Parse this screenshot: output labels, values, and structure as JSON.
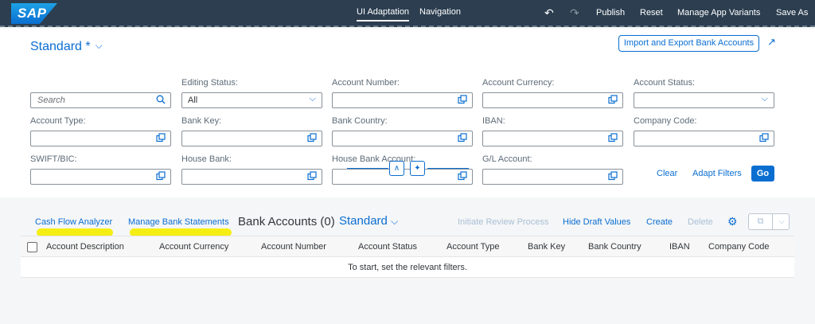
{
  "shell": {
    "logo": "SAP",
    "tabs": [
      "UI Adaptation",
      "Navigation"
    ],
    "undo_icon": "undo-icon",
    "redo_icon": "redo-icon",
    "actions": [
      "Publish",
      "Reset",
      "Manage App Variants",
      "Save As"
    ]
  },
  "header": {
    "variant": "Standard *",
    "import_export": "Import and Export Bank Accounts"
  },
  "filters": {
    "search_placeholder": "Search",
    "editing_status": {
      "label": "Editing Status:",
      "value": "All"
    },
    "account_number": "Account Number:",
    "account_currency": "Account Currency:",
    "account_status": "Account Status:",
    "account_type": "Account Type:",
    "bank_key": "Bank Key:",
    "bank_country": "Bank Country:",
    "iban": "IBAN:",
    "company_code": "Company Code:",
    "swift_bic": "SWIFT/BIC:",
    "house_bank": "House Bank:",
    "house_bank_account": "House Bank Account:",
    "gl_account": "G/L Account:",
    "clear": "Clear",
    "adapt": "Adapt Filters",
    "go": "Go"
  },
  "table": {
    "cash_flow": "Cash Flow Analyzer",
    "manage_statements": "Manage Bank Statements",
    "title": "Bank Accounts (0)",
    "variant": "Standard",
    "initiate_review": "Initiate Review Process",
    "hide_draft": "Hide Draft Values",
    "create": "Create",
    "delete": "Delete",
    "columns": [
      "Account Description",
      "Account Currency",
      "Account Number",
      "Account Status",
      "Account Type",
      "Bank Key",
      "Bank Country",
      "IBAN",
      "Company Code"
    ],
    "empty_text": "To start, set the relevant filters."
  },
  "colors": {
    "accent": "#0a6ed1",
    "shell": "#2c3e50",
    "highlight": "#f5ee14"
  }
}
